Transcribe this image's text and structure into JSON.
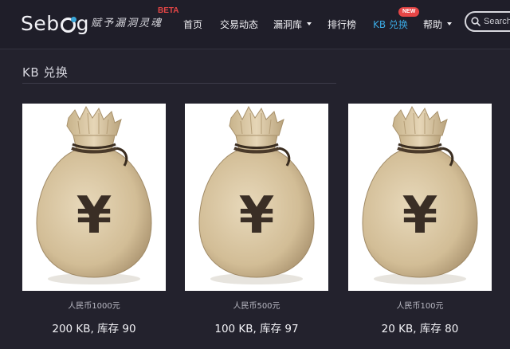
{
  "brand": {
    "logo_text_before": "Seb",
    "logo_text_after": "g",
    "slogan": "赋予漏洞灵魂",
    "beta_label": "BETA"
  },
  "nav": {
    "items": [
      {
        "label": "首页"
      },
      {
        "label": "交易动态"
      },
      {
        "label": "漏洞库"
      },
      {
        "label": "排行榜"
      },
      {
        "label": "KB 兑换"
      },
      {
        "label": "帮助"
      }
    ],
    "active_item": "KB 兑换",
    "new_badge": "NEW"
  },
  "search": {
    "placeholder": "Search"
  },
  "page": {
    "title": "KB 兑换"
  },
  "products": [
    {
      "price": "人民币1000元",
      "exchange": "200 KB, 库存 90"
    },
    {
      "price": "人民币500元",
      "exchange": "100 KB, 库存 97"
    },
    {
      "price": "人民币100元",
      "exchange": "20 KB, 库存 80"
    }
  ],
  "product_symbol": "¥",
  "colors": {
    "background": "#23222d",
    "accent": "#3aa7e0",
    "badge": "#e64646",
    "bag": "#d9c6a3",
    "bag_shadow": "#b39b74"
  },
  "icons": {
    "search": "search-icon",
    "dropdown": "chevron-down-icon",
    "product": "money-bag-icon"
  }
}
